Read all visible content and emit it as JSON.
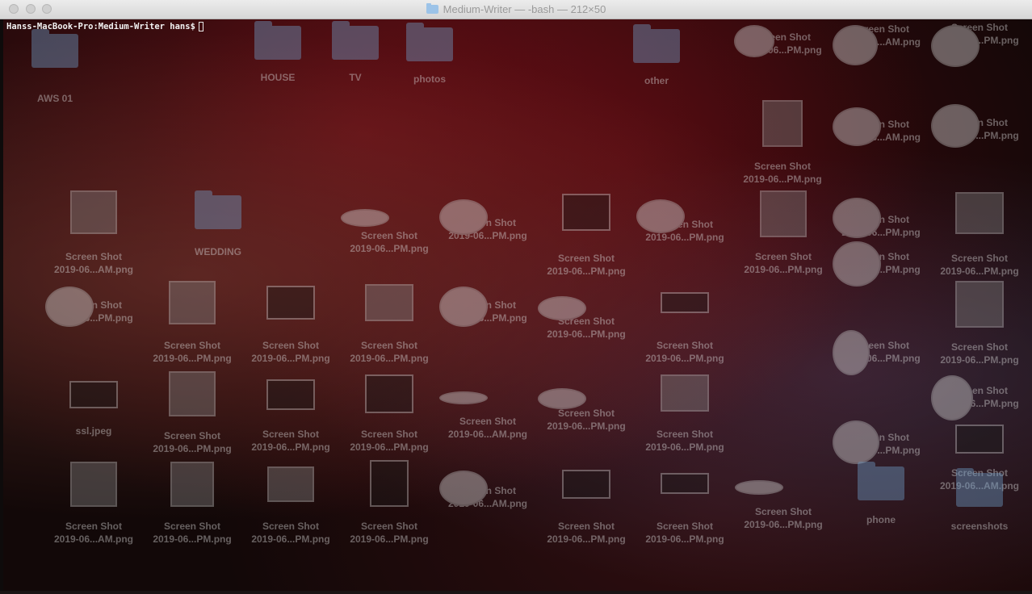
{
  "window": {
    "title": "Medium-Writer — -bash — 212×50"
  },
  "terminal": {
    "prompt": "Hanss-MacBook-Pro:Medium-Writer hans$"
  },
  "desktop": {
    "folders": [
      "AWS 01",
      "HOUSE",
      "TV",
      "photos",
      "other",
      "WEDDING",
      "phone",
      "screenshots"
    ],
    "screenshot_label": "Screen Shot",
    "file_names": {
      "am": "2019-06...AM.png",
      "pm": "2019-06...PM.png",
      "ssl": "ssl.jpeg"
    }
  }
}
